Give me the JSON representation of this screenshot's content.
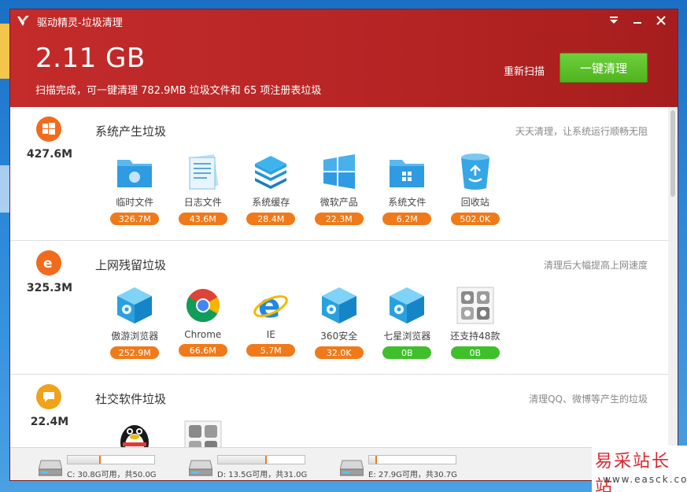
{
  "window": {
    "title": "驱动精灵-垃圾清理",
    "controls": [
      "menu",
      "minimize",
      "close"
    ]
  },
  "header": {
    "total_size": "2.11 GB",
    "summary": "扫描完成，可一键清理 782.9MB 垃圾文件和 65 项注册表垃圾",
    "rescan_label": "重新扫描",
    "clean_label": "一键清理"
  },
  "sections": [
    {
      "title": "系统产生垃圾",
      "size": "427.6M",
      "tip": "天天清理，让系统运行顺畅无阻",
      "icon": "windows-icon",
      "items": [
        {
          "label": "临时文件",
          "size": "326.7M",
          "icon": "folder-icon",
          "badge": "orange"
        },
        {
          "label": "日志文件",
          "size": "43.6M",
          "icon": "log-file-icon",
          "badge": "orange"
        },
        {
          "label": "系统缓存",
          "size": "28.4M",
          "icon": "stack-layers-icon",
          "badge": "orange"
        },
        {
          "label": "微软产品",
          "size": "22.3M",
          "icon": "windows-logo-icon",
          "badge": "orange"
        },
        {
          "label": "系统文件",
          "size": "6.2M",
          "icon": "system-folder-icon",
          "badge": "orange"
        },
        {
          "label": "回收站",
          "size": "502.0K",
          "icon": "recycle-bin-icon",
          "badge": "orange"
        }
      ]
    },
    {
      "title": "上网残留垃圾",
      "size": "325.3M",
      "tip": "清理后大幅提高上网速度",
      "icon": "ie-icon",
      "items": [
        {
          "label": "傲游浏览器",
          "size": "252.9M",
          "icon": "browser-cube-icon",
          "badge": "orange"
        },
        {
          "label": "Chrome",
          "size": "66.6M",
          "icon": "chrome-icon",
          "badge": "orange"
        },
        {
          "label": "IE",
          "size": "5.7M",
          "icon": "ie-logo-icon",
          "badge": "orange"
        },
        {
          "label": "360安全",
          "size": "32.0K",
          "icon": "browser-cube-icon",
          "badge": "orange"
        },
        {
          "label": "七星浏览器",
          "size": "0B",
          "icon": "browser-cube-icon",
          "badge": "green"
        },
        {
          "label": "还支持48款",
          "size": "0B",
          "icon": "more-browsers-icon",
          "badge": "green"
        }
      ]
    },
    {
      "title": "社交软件垃圾",
      "size": "22.4M",
      "tip": "清理QQ、微博等产生的垃圾",
      "icon": "chat-bubble-icon",
      "items": [
        {
          "label": "",
          "size": "",
          "icon": "qq-penguin-icon",
          "badge": ""
        },
        {
          "label": "",
          "size": "",
          "icon": "more-apps-icon",
          "badge": ""
        }
      ]
    }
  ],
  "drives": [
    {
      "text": "C: 30.8G可用，共50.0G",
      "used_fraction": 0.38
    },
    {
      "text": "D: 13.5G可用，共31.0G",
      "used_fraction": 0.56
    },
    {
      "text": "E: 27.9G可用，共30.7G",
      "used_fraction": 0.09
    }
  ],
  "watermark": {
    "main": "易采站长站",
    "url": "www.easck.com"
  },
  "colors": {
    "header_red": "#b52424",
    "clean_green": "#4fb41e",
    "badge_orange": "#f07a1a",
    "badge_green": "#3fbf2a"
  }
}
